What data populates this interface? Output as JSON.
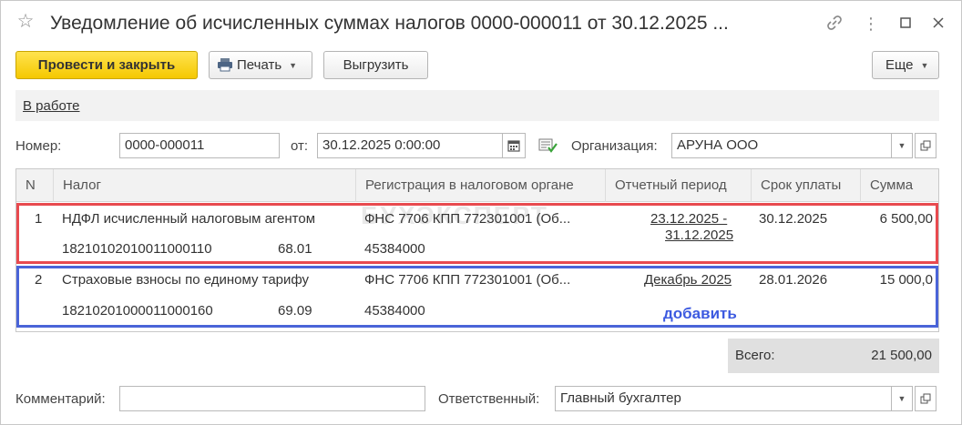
{
  "window": {
    "title": "Уведомление об исчисленных суммах налогов 0000-000011 от 30.12.2025 ..."
  },
  "toolbar": {
    "post_close_label": "Провести и закрыть",
    "print_label": "Печать",
    "export_label": "Выгрузить",
    "more_label": "Еще"
  },
  "status": {
    "label": "В работе"
  },
  "header": {
    "number_label": "Номер:",
    "number_value": "0000-000011",
    "date_label": "от:",
    "date_value": "30.12.2025  0:00:00",
    "org_label": "Организация:",
    "org_value": "АРУНА ООО"
  },
  "table": {
    "columns": [
      "N",
      "Налог",
      "Регистрация в налоговом органе",
      "Отчетный период",
      "Срок уплаты",
      "Сумма"
    ],
    "rows": [
      {
        "n": "1",
        "tax": "НДФЛ исчисленный налоговым агентом",
        "kbk": "18210102010011000110",
        "account": "68.01",
        "registration": "ФНС 7706 КПП 772301001 (Об...",
        "oktmo": "45384000",
        "period_line1": "23.12.2025 -",
        "period_line2": "31.12.2025",
        "due": "30.12.2025",
        "amount": "6 500,00"
      },
      {
        "n": "2",
        "tax": "Страховые взносы по единому тарифу",
        "kbk": "18210201000011000160",
        "account": "69.09",
        "registration": "ФНС 7706 КПП 772301001 (Об...",
        "oktmo": "45384000",
        "period_line1": "Декабрь 2025",
        "due": "28.01.2026",
        "amount": "15 000,0"
      }
    ],
    "add_label": "добавить",
    "watermark": "БУХЭКСПЕРТ"
  },
  "totals": {
    "label": "Всего:",
    "value": "21 500,00"
  },
  "footer": {
    "comment_label": "Комментарий:",
    "comment_value": "",
    "responsible_label": "Ответственный:",
    "responsible_value": "Главный бухгалтер"
  },
  "colors": {
    "primary_button": "#f5c800",
    "highlight_red": "#e84a4f",
    "highlight_blue": "#4a64d8",
    "add_text": "#3c5ae0"
  }
}
